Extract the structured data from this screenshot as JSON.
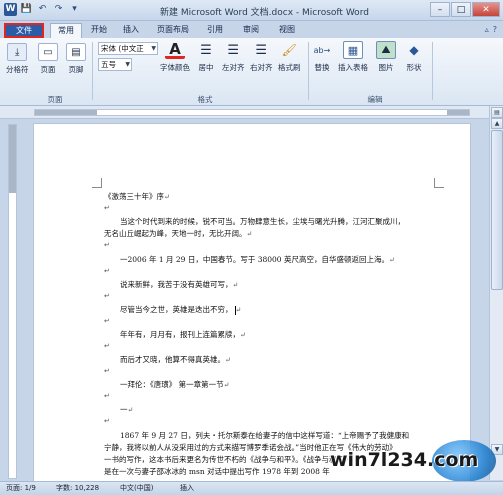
{
  "titlebar": {
    "title": "新建 Microsoft Word 文档.docx - Microsoft Word",
    "qat_icons": [
      "word-logo-icon",
      "save-icon",
      "undo-icon",
      "redo-icon",
      "customize-icon"
    ],
    "controls": {
      "minimize": "–",
      "maximize": "□",
      "close": "✕"
    }
  },
  "tabs": [
    {
      "label": "文件"
    },
    {
      "label": "常用"
    },
    {
      "label": "开始"
    },
    {
      "label": "插入"
    },
    {
      "label": "页面布局"
    },
    {
      "label": "引用"
    },
    {
      "label": "审阅"
    },
    {
      "label": "视图"
    }
  ],
  "ribbon": {
    "font_name": "宋体 (中文正",
    "font_size": "五号",
    "buttons": {
      "format_painter": "分格符",
      "page": "页面",
      "page_footer": "页脚",
      "font_color": "字体颜色",
      "center": "居中",
      "justify": "左对齐",
      "right_align": "右对齐",
      "format_brush": "格式刷",
      "replace": "替换",
      "insert_table": "插入表格",
      "picture": "图片",
      "shape": "形状"
    },
    "groups": {
      "page": "页面",
      "format": "格式",
      "edit": "编辑"
    }
  },
  "document": {
    "paragraphs": [
      "《激荡三十年》序",
      "当这个时代到来的时候，锐不可当。万物肆意生长，尘埃与曙光升腾，江河汇聚成川，",
      "无名山丘崛起为峰，天地一时，无比开阔。",
      "一2006 年 1 月 29 日，中国春节。写于 38000 英尺高空，自华盛顿返回上海。",
      "说来新鲜，我苦于没有英雄可写，",
      "尽管当今之世，英雄是迭出不穷，",
      "年年有，月月有，报刊上连篇累牍，",
      "而后才又晓，他算不得真英雄。",
      "一拜伦：《唐璜》 第一章第一节",
      "一",
      "1867 年 9 月 27 日，列夫・托尔斯泰在给妻子的信中这样写道：“上帝赐予了我健康和",
      "宁静，我将以前人从没采用过的方式来描写博罗季诺会战。”当时他正在写《伟大的劳动》",
      "一书的写作，这本书后来更名为传世不朽的《战争与和平》。《战争与和平》",
      "是在一次与妻子邵冰冰的 msn 对话中提出写作 1978 年到 2008 年"
    ],
    "paragraph_mark": "↵"
  },
  "statusbar": {
    "page": "页面: 1/9",
    "words": "字数: 10,228",
    "language": "中文(中国)",
    "mode": "插入"
  },
  "watermark": {
    "text": "win7l234.com"
  }
}
